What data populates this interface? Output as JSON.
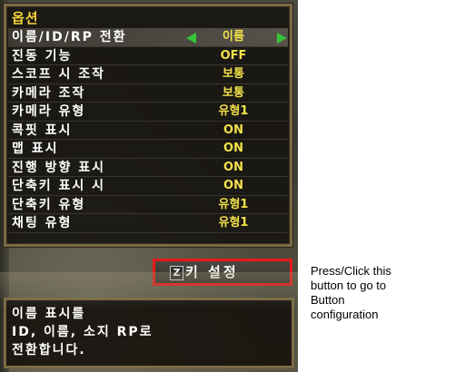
{
  "options_panel": {
    "title": "옵션",
    "rows": [
      {
        "label": "이름/ID/RP 전환",
        "value": "이름"
      },
      {
        "label": "진동 기능",
        "value": "OFF"
      },
      {
        "label": "스코프 시 조작",
        "value": "보통"
      },
      {
        "label": "카메라 조작",
        "value": "보통"
      },
      {
        "label": "카메라 유형",
        "value": "유형1"
      },
      {
        "label": "콕핏 표시",
        "value": "ON"
      },
      {
        "label": "맵 표시",
        "value": "ON"
      },
      {
        "label": "진행 방향 표시",
        "value": "ON"
      },
      {
        "label": "단축키 표시 시",
        "value": "ON"
      },
      {
        "label": "단축키 유형",
        "value": "유형1"
      },
      {
        "label": "채팅 유형",
        "value": "유형1"
      }
    ],
    "arrow_color": "#36c43a",
    "value_color": "#f2e24a",
    "title_color": "#f4d23c"
  },
  "key_config_button": {
    "key": "Z",
    "label": "키 설정",
    "highlight_color": "#e41a1a"
  },
  "description": {
    "lines": [
      "이름 표시를",
      "ID, 이름, 소지 RP로",
      "전환합니다."
    ]
  },
  "annotation": {
    "lines": [
      "Press/Click this",
      "button to go to",
      "Button",
      "configuration"
    ]
  }
}
